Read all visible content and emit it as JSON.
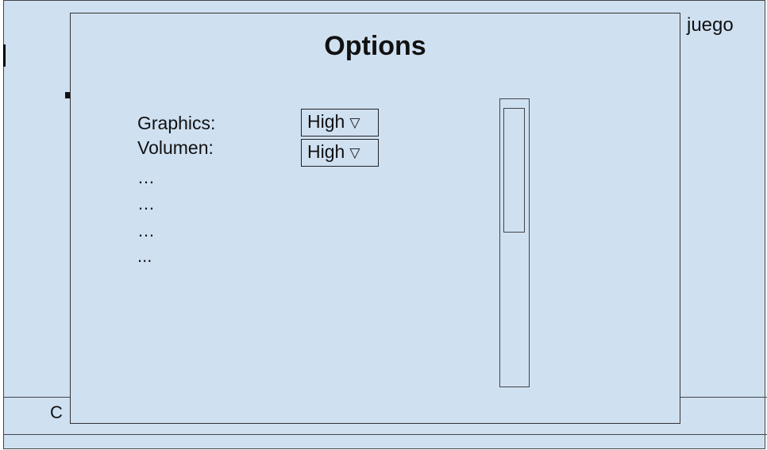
{
  "background": {
    "title_fragment": "juego",
    "footer_fragment": "C"
  },
  "dialog": {
    "title": "Options",
    "settings": [
      {
        "label": "Graphics:",
        "value": "High",
        "arrow": "▽"
      },
      {
        "label": "Volumen:",
        "value": "High",
        "arrow": "▽"
      }
    ],
    "ellipses": [
      "…",
      "…",
      "…",
      "..."
    ],
    "scrollbar": {
      "thumb_position": 0
    }
  },
  "colors": {
    "panel_background": "#cfe0f1",
    "border": "#333333"
  }
}
